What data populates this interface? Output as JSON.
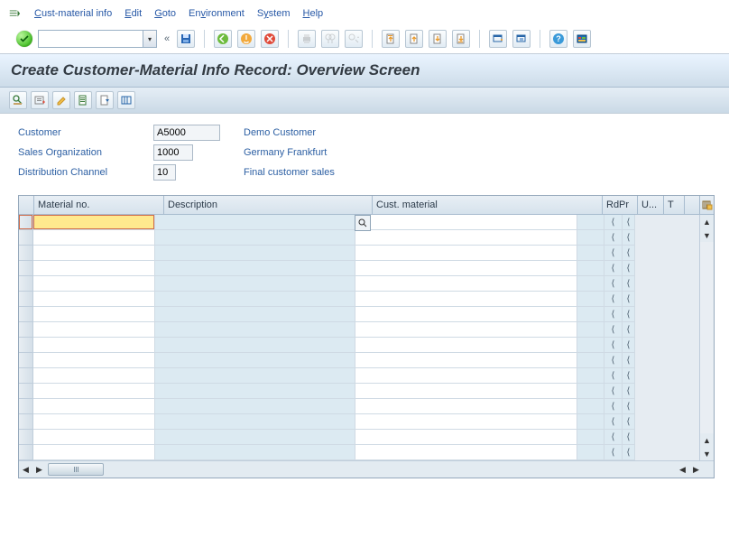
{
  "menu": {
    "cust_material_info": "Cust-material info",
    "edit": "Edit",
    "goto": "Goto",
    "environment": "Environment",
    "system": "System",
    "help": "Help"
  },
  "sysbar": {
    "okcode_value": "",
    "back_arrows": "«"
  },
  "title": "Create Customer-Material Info Record: Overview Screen",
  "toolbar_icons": {
    "t1": "detail-icon",
    "t2": "copy-icon",
    "t3": "edit-icon",
    "t4": "export-icon",
    "t5": "transfer-icon",
    "t6": "layout-icon"
  },
  "header": {
    "customer": {
      "label": "Customer",
      "value": "A5000",
      "desc": "Demo Customer"
    },
    "sales_org": {
      "label": "Sales Organization",
      "value": "1000",
      "desc": "Germany Frankfurt"
    },
    "dist_channel": {
      "label": "Distribution Channel",
      "value": "10",
      "desc": "Final customer sales"
    }
  },
  "table": {
    "cols": {
      "material_no": "Material no.",
      "description": "Description",
      "cust_material": "Cust. material",
      "rdpr": "RdPr",
      "u": "U...",
      "t": "T"
    },
    "right_bracket": "⟨",
    "row_count": 16
  }
}
